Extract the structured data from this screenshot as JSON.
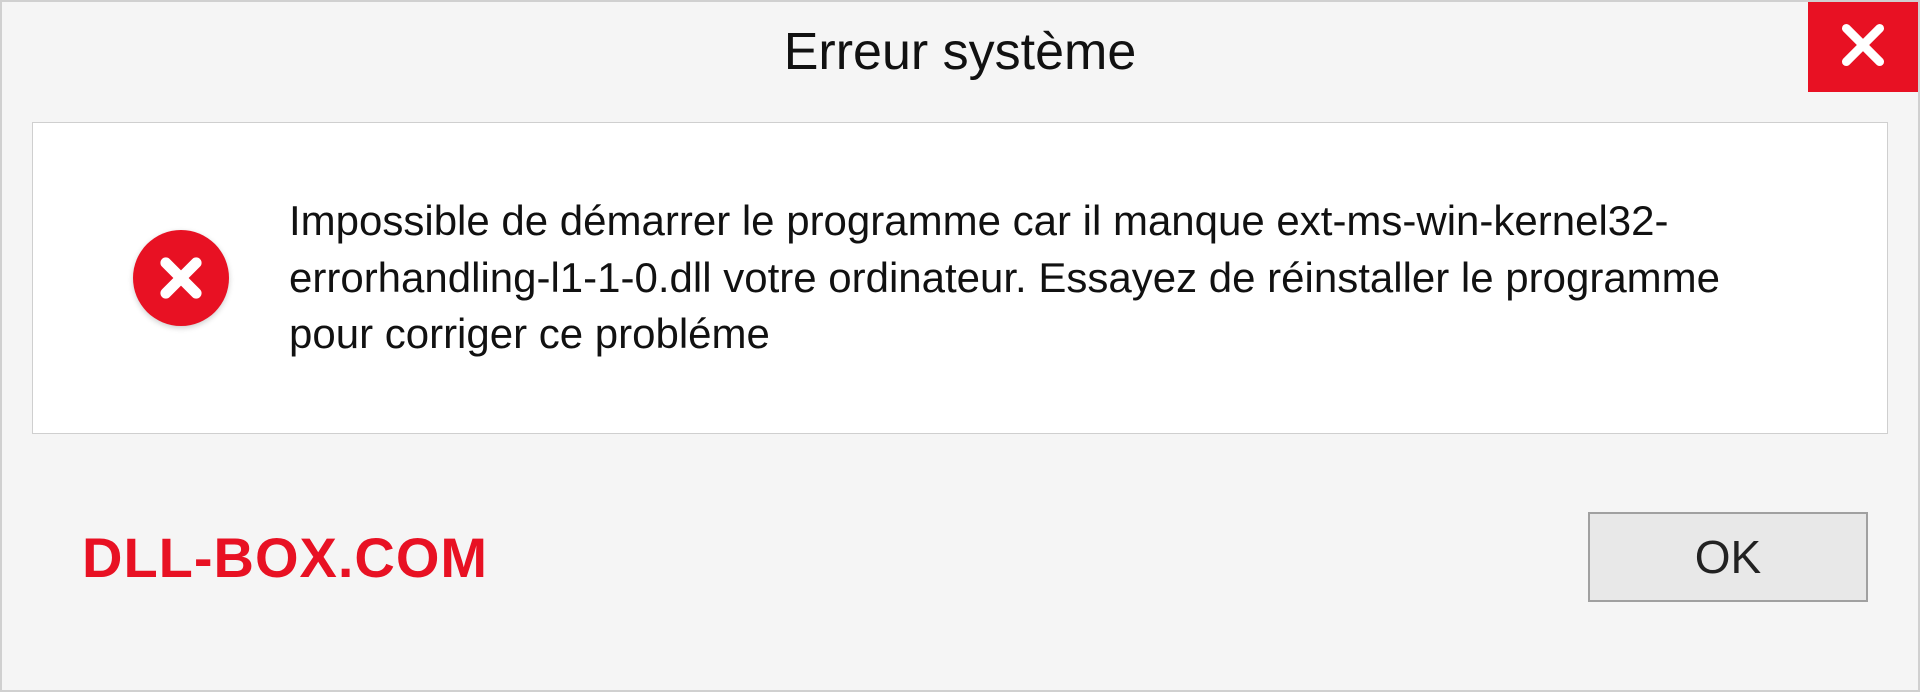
{
  "dialog": {
    "title": "Erreur système",
    "message": "Impossible de démarrer le programme car il manque ext-ms-win-kernel32-errorhandling-l1-1-0.dll votre ordinateur. Essayez de réinstaller le programme pour corriger ce probléme",
    "ok_label": "OK",
    "watermark": "DLL-BOX.COM"
  },
  "colors": {
    "accent_red": "#e81123",
    "panel_bg": "#f5f5f5",
    "content_bg": "#ffffff",
    "border": "#cfcfcf"
  },
  "icons": {
    "close": "close-icon",
    "error": "error-circle-x-icon"
  }
}
